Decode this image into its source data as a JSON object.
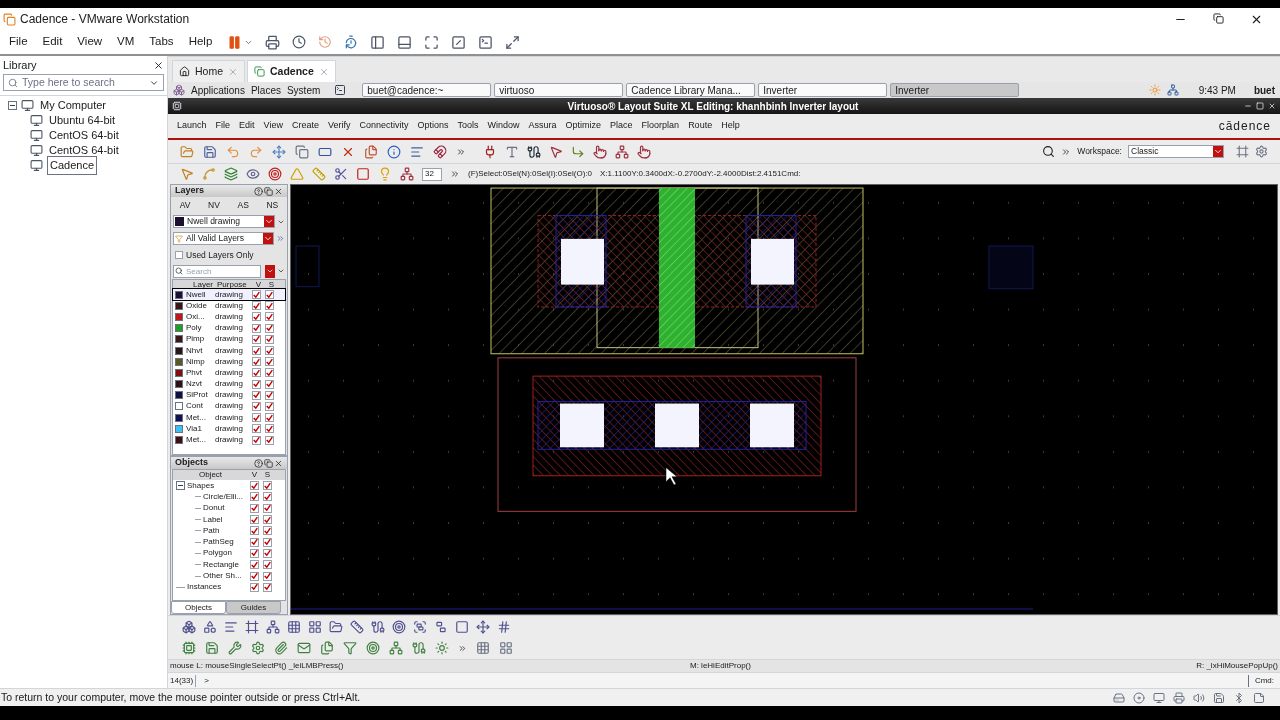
{
  "window": {
    "title": "Cadence - VMware Workstation"
  },
  "menu": [
    "File",
    "Edit",
    "View",
    "VM",
    "Tabs",
    "Help"
  ],
  "library": {
    "title": "Library",
    "search": {
      "placeholder": "Type here to search"
    },
    "tree": [
      {
        "label": "My Computer",
        "expanded": true,
        "selected": false,
        "children": [
          {
            "label": "Ubuntu 64-bit",
            "selected": false
          },
          {
            "label": "CentOS 64-bit",
            "selected": false
          },
          {
            "label": "CentOS 64-bit",
            "selected": false
          },
          {
            "label": "Cadence",
            "selected": true
          }
        ]
      }
    ]
  },
  "vm_tabs": [
    {
      "label": "Home",
      "selected": false
    },
    {
      "label": "Cadence",
      "selected": true
    }
  ],
  "panel": {
    "menus": [
      "Applications",
      "Places",
      "System"
    ],
    "tasks": [
      {
        "label": "buet@cadence:~",
        "selected": false
      },
      {
        "label": "virtuoso",
        "selected": false
      },
      {
        "label": "Cadence Library Mana...",
        "selected": false
      },
      {
        "label": "Inverter",
        "selected": false
      },
      {
        "label": "Inverter",
        "selected": true
      }
    ],
    "clock": "9:43 PM",
    "user": "buet"
  },
  "virtuoso": {
    "title": "Virtuoso® Layout Suite XL Editing: khanhbinh Inverter layout",
    "brand": "cādence",
    "menu": [
      "Launch",
      "File",
      "Edit",
      "View",
      "Create",
      "Verify",
      "Connectivity",
      "Options",
      "Tools",
      "Window",
      "Assura",
      "Optimize",
      "Place",
      "Floorplan",
      "Route",
      "Help"
    ],
    "workspace": {
      "label": "Workspace:",
      "value": "Classic"
    },
    "depth": "32",
    "selection": "(F)Select:0Sel(N):0Sel(I):0Sel(O):0",
    "coords": "X:1.1100Y:0.3400dX:-0.2700dY:-2.4000Dist:2.4151Cmd:"
  },
  "layers": {
    "title": "Layers",
    "modes": [
      "AV",
      "NV",
      "AS",
      "NS"
    ],
    "current": {
      "label": "Nwell drawing",
      "color": "#1c1030"
    },
    "filter": "All Valid Layers",
    "used_only": {
      "label": "Used Layers Only",
      "checked": false
    },
    "search": {
      "placeholder": "Search"
    },
    "columns": [
      "Layer",
      "Purpose",
      "V",
      "S"
    ],
    "rows": [
      {
        "layer": "Nwell",
        "purpose": "drawing",
        "color": "#1c1030",
        "visible": true,
        "selectable": true,
        "selected": true
      },
      {
        "layer": "Oxide",
        "purpose": "drawing",
        "color": "#3a1410",
        "visible": true,
        "selectable": true,
        "selected": false
      },
      {
        "layer": "Oxi...",
        "purpose": "drawing",
        "color": "#c01818",
        "visible": true,
        "selectable": true,
        "selected": false
      },
      {
        "layer": "Poly",
        "purpose": "drawing",
        "color": "#20a020",
        "visible": true,
        "selectable": true,
        "selected": false
      },
      {
        "layer": "Pimp",
        "purpose": "drawing",
        "color": "#3a1818",
        "visible": true,
        "selectable": true,
        "selected": false
      },
      {
        "layer": "Nhvt",
        "purpose": "drawing",
        "color": "#2a1414",
        "visible": true,
        "selectable": true,
        "selected": false
      },
      {
        "layer": "Nimp",
        "purpose": "drawing",
        "color": "#5a5a20",
        "visible": true,
        "selectable": true,
        "selected": false
      },
      {
        "layer": "Phvt",
        "purpose": "drawing",
        "color": "#801010",
        "visible": true,
        "selectable": true,
        "selected": false
      },
      {
        "layer": "Nzvt",
        "purpose": "drawing",
        "color": "#301010",
        "visible": true,
        "selectable": true,
        "selected": false
      },
      {
        "layer": "SiProt",
        "purpose": "drawing",
        "color": "#101040",
        "visible": true,
        "selectable": true,
        "selected": false
      },
      {
        "layer": "Cont",
        "purpose": "drawing",
        "color": "#ffffff",
        "visible": true,
        "selectable": true,
        "selected": false
      },
      {
        "layer": "Met...",
        "purpose": "drawing",
        "color": "#101050",
        "visible": true,
        "selectable": true,
        "selected": false
      },
      {
        "layer": "Via1",
        "purpose": "drawing",
        "color": "#40c0f0",
        "visible": true,
        "selectable": true,
        "selected": false
      },
      {
        "layer": "Met...",
        "purpose": "drawing",
        "color": "#401010",
        "visible": true,
        "selectable": true,
        "selected": false
      }
    ]
  },
  "objects": {
    "title": "Objects",
    "columns": [
      "Object",
      "V",
      "S"
    ],
    "tree": [
      {
        "label": "Shapes",
        "expanded": true,
        "visible": true,
        "selectable": true,
        "children": [
          {
            "label": "Circle/Elli...",
            "visible": true,
            "selectable": true
          },
          {
            "label": "Donut",
            "visible": true,
            "selectable": true
          },
          {
            "label": "Label",
            "visible": true,
            "selectable": true
          },
          {
            "label": "Path",
            "visible": true,
            "selectable": true
          },
          {
            "label": "PathSeg",
            "visible": true,
            "selectable": true
          },
          {
            "label": "Polygon",
            "visible": true,
            "selectable": true
          },
          {
            "label": "Rectangle",
            "visible": true,
            "selectable": true
          },
          {
            "label": "Other Sh...",
            "visible": true,
            "selectable": true
          }
        ]
      },
      {
        "label": "Instances",
        "visible": true,
        "selectable": true
      }
    ],
    "tabs": [
      {
        "label": "Objects",
        "selected": true
      },
      {
        "label": "Guides",
        "selected": false
      }
    ]
  },
  "mouse": {
    "left": "mouse L: mouseSingleSelectPt() _leiLMBPress()",
    "middle": "M: leHiEditProp()",
    "right": "R: _lxHiMousePopUp()"
  },
  "command": {
    "count": "14(33)",
    "prompt": ">",
    "label": "Cmd:"
  },
  "hint": "To return to your computer, move the mouse pointer outside or press Ctrl+Alt."
}
